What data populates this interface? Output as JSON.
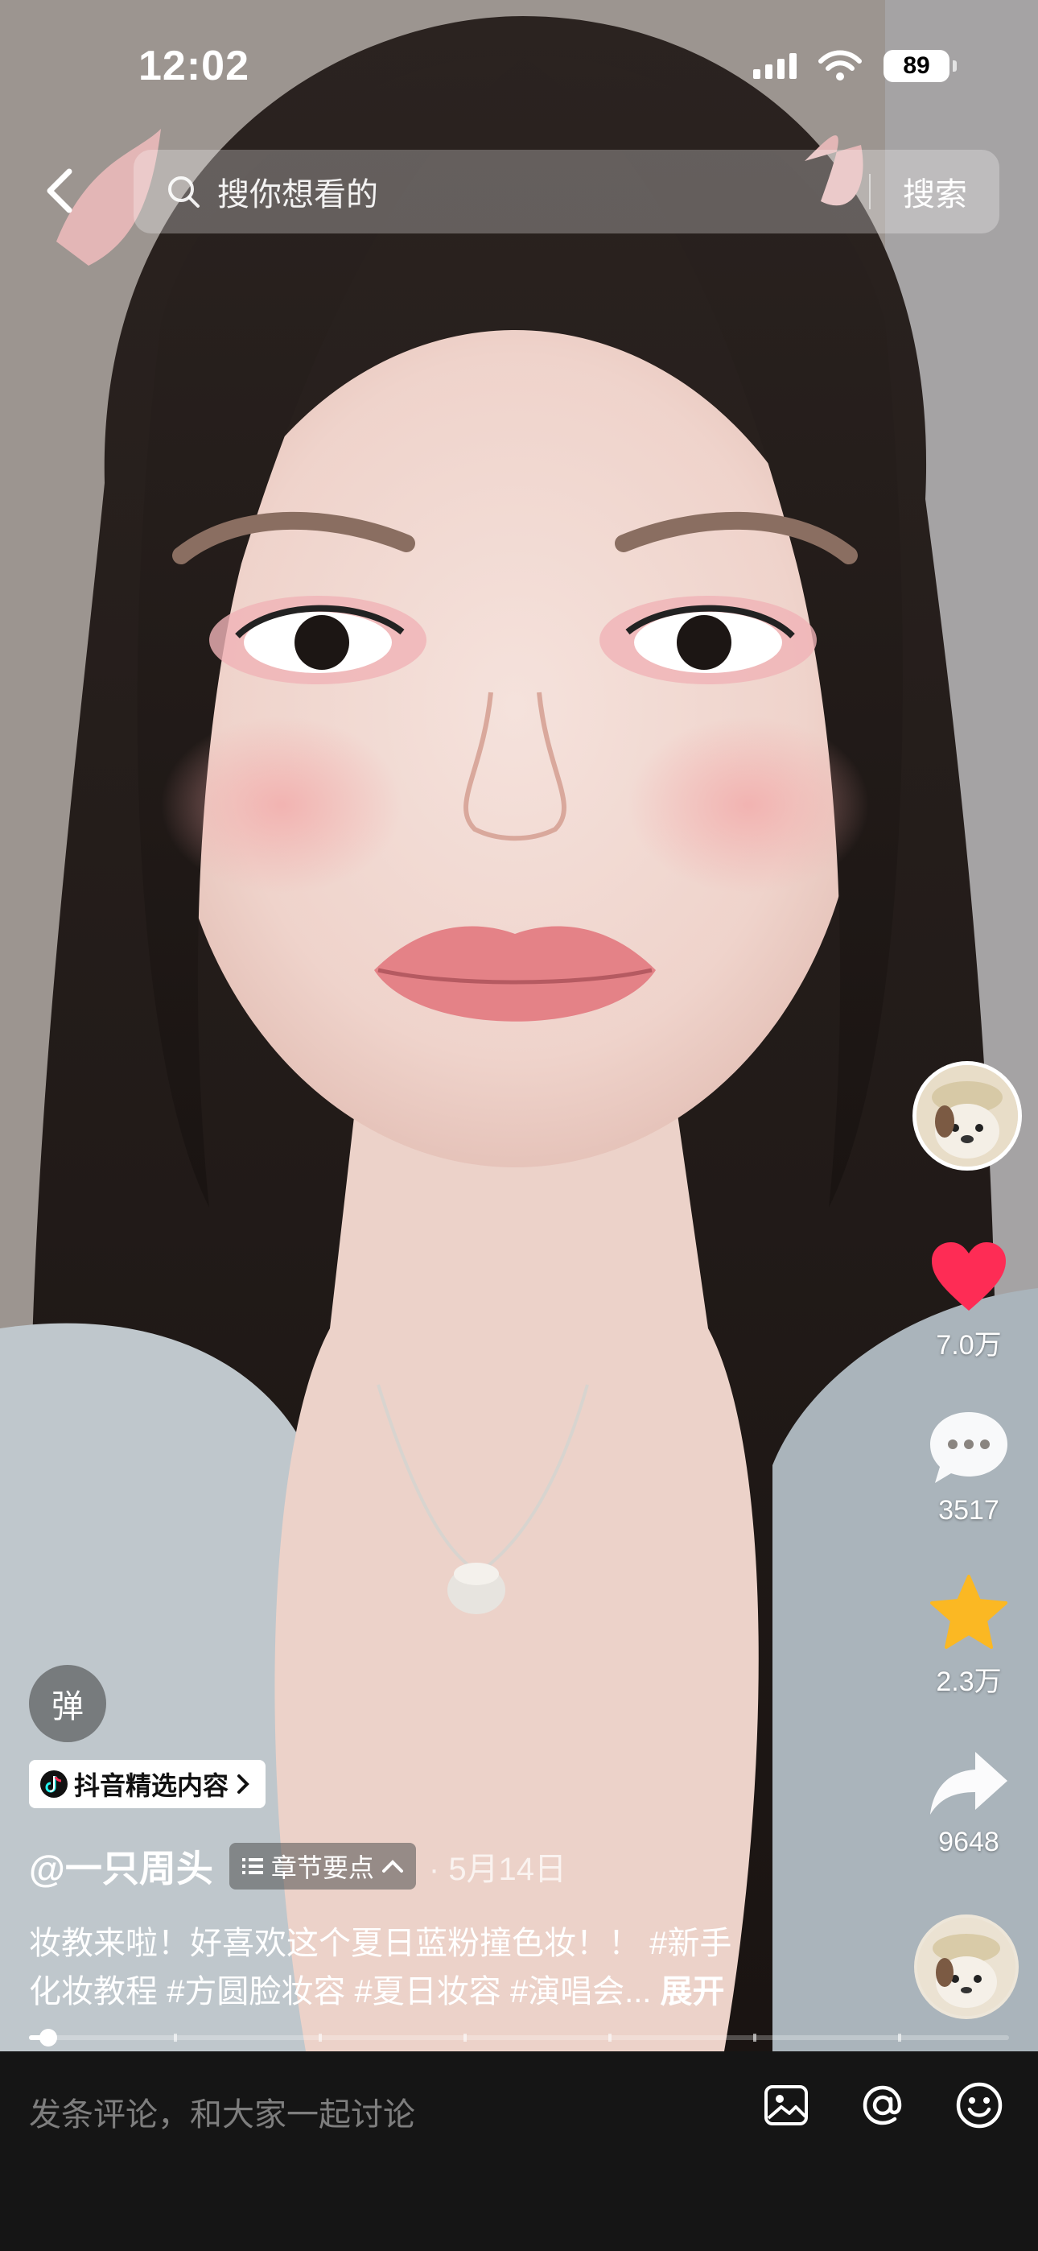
{
  "status_bar": {
    "time": "12:02",
    "battery": "89"
  },
  "header": {
    "search_placeholder": "搜你想看的",
    "search_button": "搜索"
  },
  "actions": {
    "like_count": "7.0万",
    "comment_count": "3517",
    "favorite_count": "2.3万",
    "share_count": "9648"
  },
  "colors": {
    "like": "#fe2c55",
    "favorite": "#fbb823"
  },
  "danmu_label": "弹",
  "featured_badge": "抖音精选内容",
  "author": {
    "name": "@一只周头",
    "date": "5月14日"
  },
  "chapter_button": "章节要点",
  "caption": {
    "line1": "妆教来啦！好喜欢这个夏日蓝粉撞色妆！！ #新手",
    "line2": "化妆教程 #方圆脸妆容 #夏日妆容 #演唱会...",
    "expand": "展开"
  },
  "progress": {
    "played_fraction": 0.02
  },
  "comment_bar": {
    "placeholder": "发条评论，和大家一起讨论"
  }
}
